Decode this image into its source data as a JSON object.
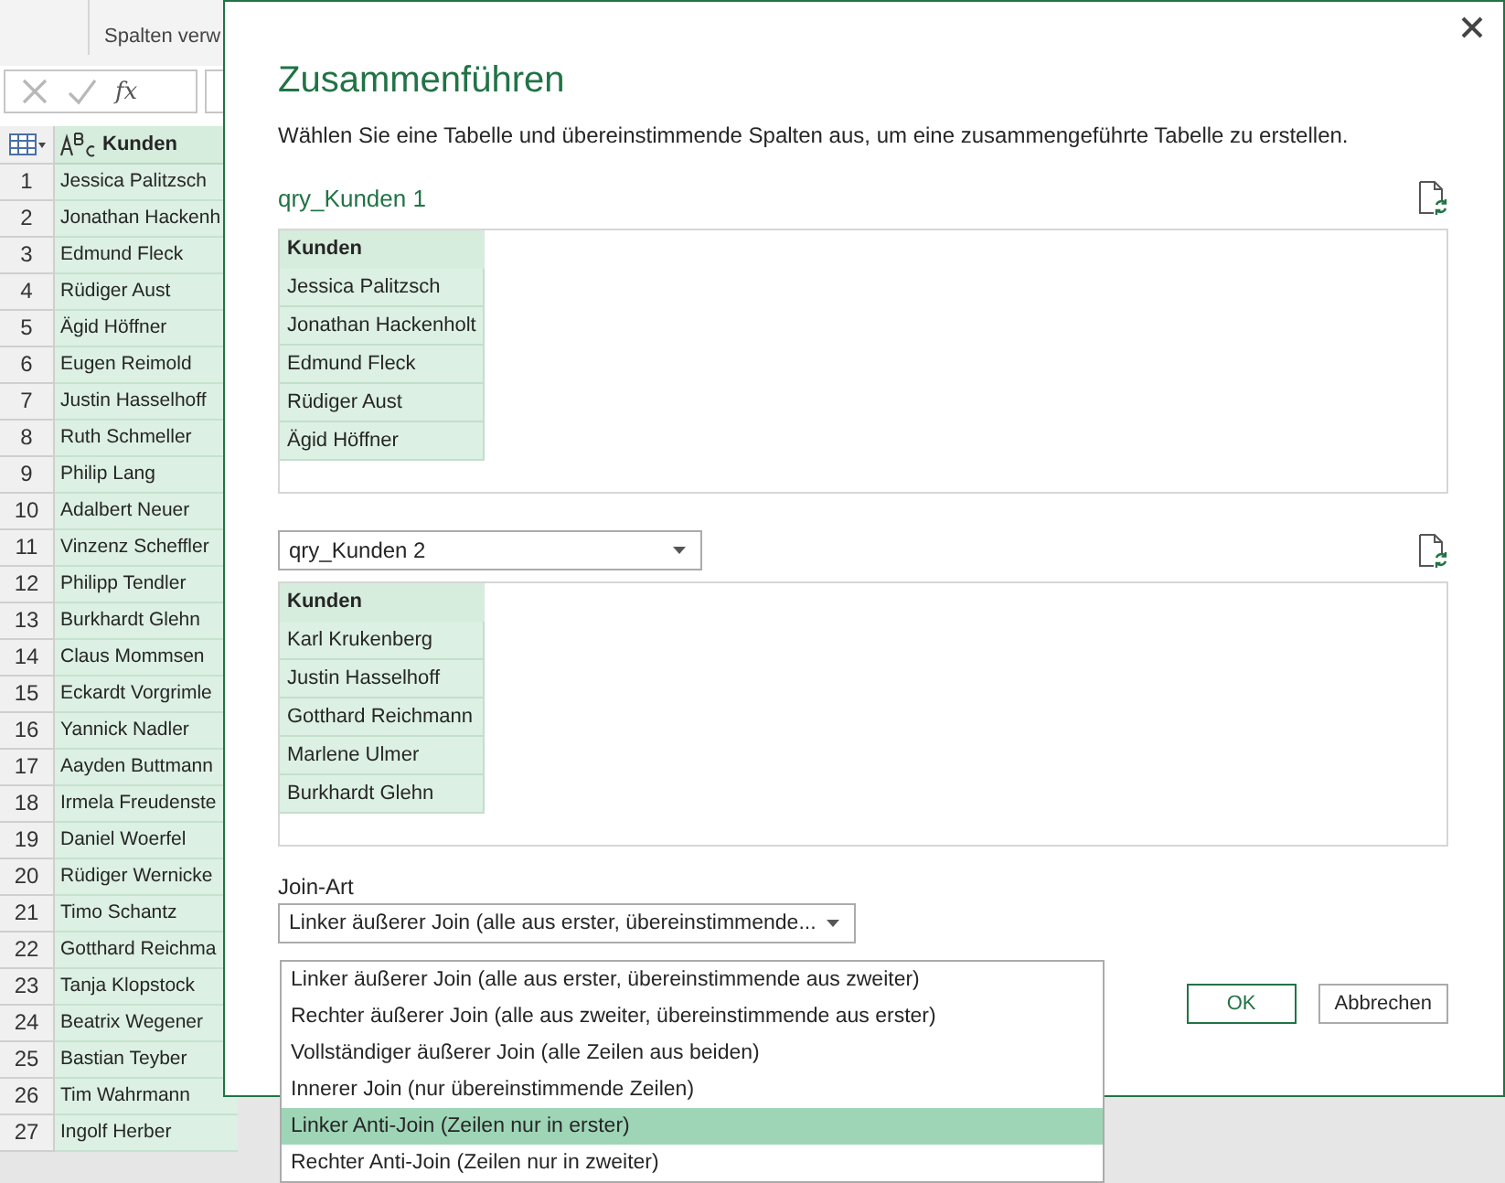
{
  "ribbon": {
    "group_label": "Spalten verw"
  },
  "formula_bar": {
    "function_label": "fx"
  },
  "grid": {
    "column": "Kunden",
    "rows": [
      {
        "number": "1",
        "name": "Jessica Palitzsch"
      },
      {
        "number": "2",
        "name": "Jonathan Hackenh"
      },
      {
        "number": "3",
        "name": "Edmund Fleck"
      },
      {
        "number": "4",
        "name": "Rüdiger Aust"
      },
      {
        "number": "5",
        "name": "Ägid Höffner"
      },
      {
        "number": "6",
        "name": "Eugen Reimold"
      },
      {
        "number": "7",
        "name": "Justin Hasselhoff"
      },
      {
        "number": "8",
        "name": "Ruth Schmeller"
      },
      {
        "number": "9",
        "name": "Philip Lang"
      },
      {
        "number": "10",
        "name": "Adalbert Neuer"
      },
      {
        "number": "11",
        "name": "Vinzenz Scheffler"
      },
      {
        "number": "12",
        "name": "Philipp Tendler"
      },
      {
        "number": "13",
        "name": "Burkhardt Glehn"
      },
      {
        "number": "14",
        "name": "Claus Mommsen"
      },
      {
        "number": "15",
        "name": "Eckardt Vorgrimle"
      },
      {
        "number": "16",
        "name": "Yannick Nadler"
      },
      {
        "number": "17",
        "name": "Aayden Buttmann"
      },
      {
        "number": "18",
        "name": "Irmela Freudenste"
      },
      {
        "number": "19",
        "name": "Daniel Woerfel"
      },
      {
        "number": "20",
        "name": "Rüdiger Wernicke"
      },
      {
        "number": "21",
        "name": "Timo Schantz"
      },
      {
        "number": "22",
        "name": "Gotthard Reichma"
      },
      {
        "number": "23",
        "name": "Tanja Klopstock"
      },
      {
        "number": "24",
        "name": "Beatrix Wegener"
      },
      {
        "number": "25",
        "name": "Bastian Teyber"
      },
      {
        "number": "26",
        "name": "Tim Wahrmann"
      },
      {
        "number": "27",
        "name": "Ingolf Herber"
      }
    ]
  },
  "dialog": {
    "title": "Zusammenführen",
    "description": "Wählen Sie eine Tabelle und übereinstimmende Spalten aus, um eine zusammengeführte Tabelle zu erstellen.",
    "first_table": {
      "name": "qry_Kunden 1",
      "column": "Kunden",
      "rows": [
        "Jessica Palitzsch",
        "Jonathan Hackenholt",
        "Edmund Fleck",
        "Rüdiger Aust",
        "Ägid Höffner"
      ]
    },
    "second_table": {
      "name": "qry_Kunden 2",
      "column": "Kunden",
      "rows": [
        "Karl Krukenberg",
        "Justin Hasselhoff",
        "Gotthard Reichmann",
        "Marlene Ulmer",
        "Burkhardt Glehn"
      ]
    },
    "join_label": "Join-Art",
    "join_value": "Linker äußerer Join (alle aus erster, übereinstimmende...",
    "join_options": [
      {
        "label": "Linker äußerer Join (alle aus erster, übereinstimmende aus zweiter)",
        "selected": false
      },
      {
        "label": "Rechter äußerer Join (alle aus zweiter, übereinstimmende aus erster)",
        "selected": false
      },
      {
        "label": "Vollständiger äußerer Join (alle Zeilen aus beiden)",
        "selected": false
      },
      {
        "label": "Innerer Join (nur übereinstimmende Zeilen)",
        "selected": false
      },
      {
        "label": "Linker Anti-Join (Zeilen nur in erster)",
        "selected": true
      },
      {
        "label": "Rechter Anti-Join (Zeilen nur in zweiter)",
        "selected": false
      }
    ],
    "buttons": [
      {
        "label": "OK",
        "default": true
      },
      {
        "label": "Abbrechen",
        "default": false
      }
    ]
  }
}
